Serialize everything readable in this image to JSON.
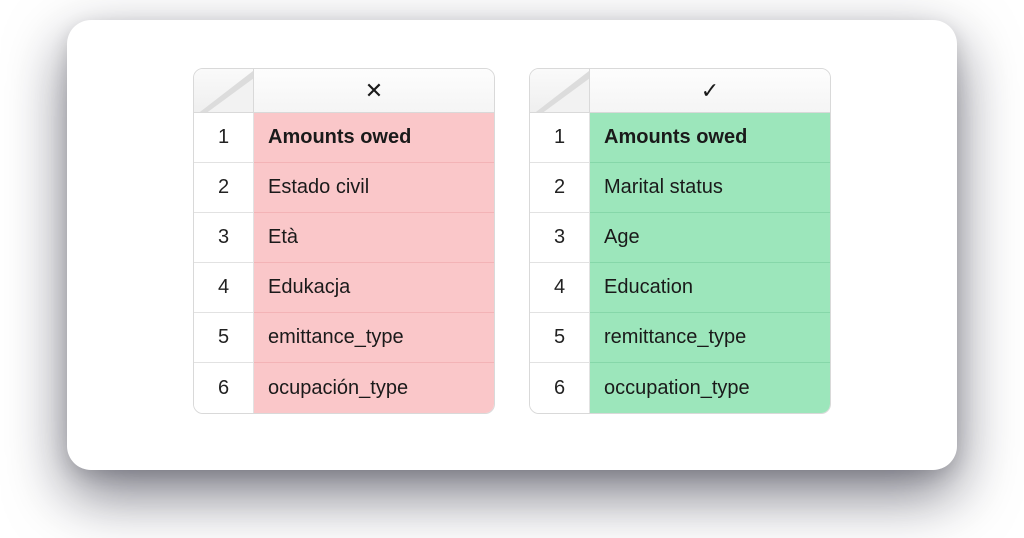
{
  "bad_table": {
    "header_icon": "✕",
    "rows": [
      {
        "n": "1",
        "v": "Amounts owed",
        "bold": true
      },
      {
        "n": "2",
        "v": "Estado civil",
        "bold": false
      },
      {
        "n": "3",
        "v": "Età",
        "bold": false
      },
      {
        "n": "4",
        "v": "Edukacja",
        "bold": false
      },
      {
        "n": "5",
        "v": "emittance_type",
        "bold": false
      },
      {
        "n": "6",
        "v": "ocupación_type",
        "bold": false
      }
    ]
  },
  "good_table": {
    "header_icon": "✓",
    "rows": [
      {
        "n": "1",
        "v": "Amounts owed",
        "bold": true
      },
      {
        "n": "2",
        "v": "Marital status",
        "bold": false
      },
      {
        "n": "3",
        "v": "Age",
        "bold": false
      },
      {
        "n": "4",
        "v": "Education",
        "bold": false
      },
      {
        "n": "5",
        "v": "remittance_type",
        "bold": false
      },
      {
        "n": "6",
        "v": "occupation_type",
        "bold": false
      }
    ]
  }
}
